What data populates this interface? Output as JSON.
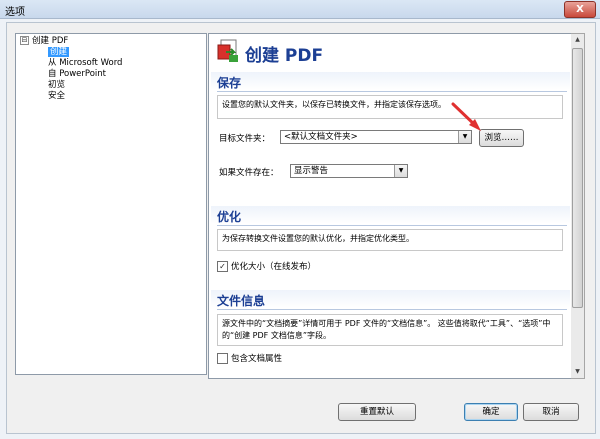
{
  "window": {
    "title": "选项",
    "close_glyph": "X"
  },
  "tree": {
    "root": {
      "expander": "⊟",
      "label": "创建 PDF"
    },
    "items": [
      {
        "label": "创建",
        "selected": true
      },
      {
        "label": "从 Microsoft Word",
        "selected": false
      },
      {
        "label": "自 PowerPoint",
        "selected": false
      },
      {
        "label": "初览",
        "selected": false
      },
      {
        "label": "安全",
        "selected": false
      }
    ]
  },
  "panel": {
    "header_title": "创建 PDF",
    "header_icon": "pdf-create-icon",
    "save": {
      "title": "保存",
      "description": "设置您的默认文件夹，以保存已转换文件，并指定该保存选项。",
      "target_label": "目标文件夹：",
      "target_value": "<默认文档文件夹>",
      "browse_label": "浏览……",
      "exists_label": "如果文件存在：",
      "exists_value": "显示警告"
    },
    "optimize": {
      "title": "优化",
      "description": "为保存转换文件设置您的默认优化，并指定优化类型。",
      "checkbox_label": "优化大小（在线发布）",
      "checkbox_checked": true
    },
    "fileinfo": {
      "title": "文件信息",
      "description": "源文件中的“文档摘要”详情可用于 PDF 文件的“文档信息”。 这些值将取代“工具”、“选项”中的“创建 PDF 文档信息”字段。",
      "checkbox_label": "包含文档属性",
      "checkbox_checked": false
    }
  },
  "buttons": {
    "reset": "重置默认",
    "ok": "确定",
    "cancel": "取消"
  },
  "colors": {
    "accent": "#1c3f94",
    "selection": "#3399ff",
    "annotation_arrow": "#e03030"
  }
}
